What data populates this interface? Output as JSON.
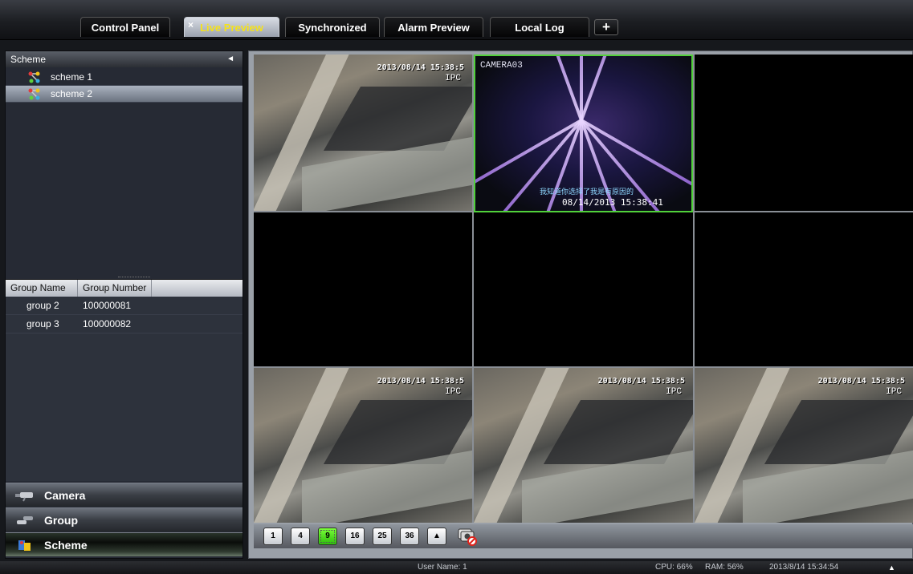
{
  "tabs": [
    {
      "label": "Control Panel",
      "active": false
    },
    {
      "label": "Live Preview",
      "active": true
    },
    {
      "label": "Synchronized",
      "active": false
    },
    {
      "label": "Alarm Preview",
      "active": false
    },
    {
      "label": "Local Log",
      "active": false
    }
  ],
  "tab_add_label": "+",
  "tab_close_glyph": "×",
  "scheme_panel": {
    "title": "Scheme",
    "collapse_glyph": "◄",
    "items": [
      {
        "label": "scheme 1",
        "icon": "scheme-tree-icon",
        "selected": false
      },
      {
        "label": "scheme 2",
        "icon": "scheme-tree-icon",
        "selected": true
      }
    ]
  },
  "group_table": {
    "columns": [
      "Group Name",
      "Group Number"
    ],
    "rows": [
      {
        "name": "group 2",
        "number": "100000081"
      },
      {
        "name": "group 3",
        "number": "100000082"
      }
    ]
  },
  "accordion": [
    {
      "label": "Camera",
      "icon": "camera-icon",
      "active": false
    },
    {
      "label": "Group",
      "icon": "group-icon",
      "active": false
    },
    {
      "label": "Scheme",
      "icon": "scheme-icon",
      "active": true
    }
  ],
  "video_cells": [
    {
      "type": "ipc",
      "timestamp": "2013/08/14 15:38:5",
      "label": "IPC"
    },
    {
      "type": "camera",
      "name": "CAMERA03",
      "subtitle": "我知道你选择了我是有原因的",
      "timestamp": "08/14/2013 15:38:41",
      "selected": true
    },
    {
      "type": "empty"
    },
    {
      "type": "empty"
    },
    {
      "type": "empty"
    },
    {
      "type": "empty"
    },
    {
      "type": "ipc",
      "timestamp": "2013/08/14 15:38:5",
      "label": "IPC"
    },
    {
      "type": "ipc",
      "timestamp": "2013/08/14 15:38:5",
      "label": "IPC"
    },
    {
      "type": "ipc",
      "timestamp": "2013/08/14 15:38:5",
      "label": "IPC"
    }
  ],
  "layout_buttons": [
    {
      "label": "1",
      "active": false
    },
    {
      "label": "4",
      "active": false
    },
    {
      "label": "9",
      "active": true
    },
    {
      "label": "16",
      "active": false
    },
    {
      "label": "25",
      "active": false
    },
    {
      "label": "36",
      "active": false
    },
    {
      "label": "▲",
      "active": false
    }
  ],
  "layout_extra_icon": "stop-all-preview-icon",
  "status": {
    "user": "User Name: 1",
    "cpu": "CPU: 66%",
    "ram": "RAM: 56%",
    "datetime": "2013/8/14 15:34:54",
    "arrow": "▲"
  },
  "colors": {
    "active_tab_text": "#f5e21b",
    "selected_cell_border": "#51d13a",
    "active_layout_button": "#2ebd0c"
  }
}
